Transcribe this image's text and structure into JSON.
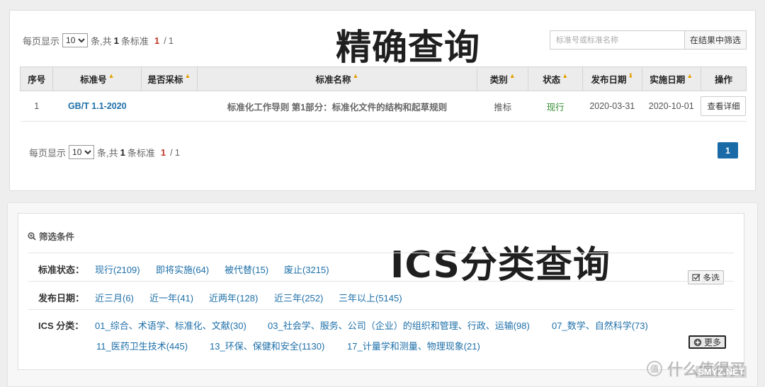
{
  "exact_query": {
    "title": "精确查询",
    "pager_top": {
      "prefix": "每页显示",
      "page_size": "10",
      "middle": "条,共",
      "total": "1",
      "suffix": "条标准",
      "current": "1",
      "sep": "/",
      "pages": "1"
    },
    "search": {
      "placeholder": "标准号或标准名称",
      "button": "在结果中筛选"
    },
    "table": {
      "headers": [
        "序号",
        "标准号",
        "是否采标",
        "标准名称",
        "类别",
        "状态",
        "发布日期",
        "实施日期",
        "操作"
      ],
      "sort_marks": {
        "std_no": "▲",
        "adopted": "▲",
        "name": "▲",
        "category": "▲",
        "state": "▲",
        "publish_date": "⬇",
        "impl_date": "▲"
      },
      "rows": [
        {
          "index": "1",
          "std_no": "GB/T 1.1-2020",
          "adopted": "",
          "name": "标准化工作导则 第1部分：标准化文件的结构和起草规则",
          "category": "推标",
          "state": "现行",
          "publish_date": "2020-03-31",
          "impl_date": "2020-10-01",
          "action": "查看详细"
        }
      ]
    },
    "pager_bottom": {
      "prefix": "每页显示",
      "page_size": "10",
      "middle": "条,共",
      "total": "1",
      "suffix": "条标准",
      "current": "1",
      "sep": "/",
      "pages": "1"
    },
    "page_button": "1"
  },
  "ics_query": {
    "title": "ICS分类查询",
    "filter_heading": "筛选条件",
    "status": {
      "label": "标准状态：",
      "options": [
        "现行(2109)",
        "即将实施(64)",
        "被代替(15)",
        "废止(3215)"
      ],
      "multi_button": "多选"
    },
    "publish": {
      "label": "发布日期：",
      "options": [
        "近三月(6)",
        "近一年(41)",
        "近两年(128)",
        "近三年(252)",
        "三年以上(5145)"
      ]
    },
    "ics": {
      "label": "ICS 分类：",
      "options": [
        "01_综合、术语学、标准化、文献(30)",
        "03_社会学、服务、公司（企业）的组织和管理、行政、运输(98)",
        "07_数学、自然科学(73)",
        "11_医药卫生技术(445)",
        "13_环保、保健和安全(1130)",
        "17_计量学和测量、物理现象(21)"
      ],
      "more_button": "更多"
    }
  },
  "watermark": {
    "text": "什么值得买",
    "url": "SMYZ.NET"
  },
  "colors": {
    "link": "#1e6fa8",
    "active_state": "#2e8b2e",
    "page_active": "#1a6aa8",
    "sort_mark": "#e3a000",
    "current_page": "#c0392b"
  }
}
